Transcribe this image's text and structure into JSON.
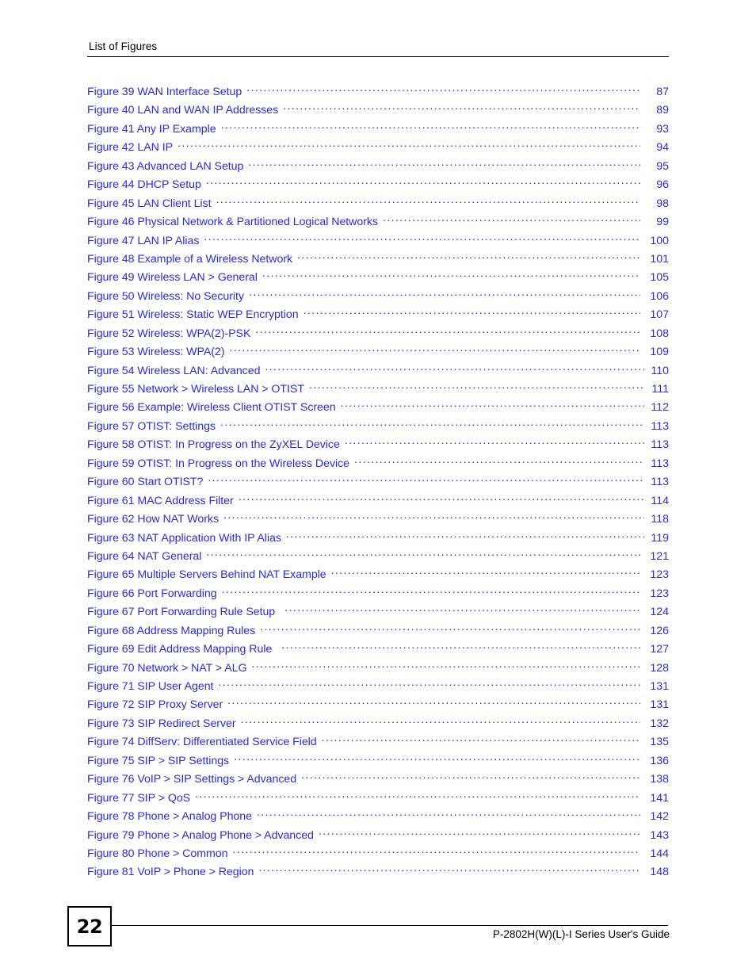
{
  "header": {
    "title": "List of Figures"
  },
  "toc": {
    "entries": [
      {
        "label": "Figure 39 WAN Interface Setup",
        "page": "87"
      },
      {
        "label": "Figure 40 LAN and WAN IP Addresses",
        "page": "89"
      },
      {
        "label": "Figure 41 Any IP Example",
        "page": "93"
      },
      {
        "label": "Figure 42 LAN IP",
        "page": "94"
      },
      {
        "label": "Figure 43 Advanced LAN Setup",
        "page": "95"
      },
      {
        "label": "Figure 44 DHCP Setup",
        "page": "96"
      },
      {
        "label": "Figure 45 LAN Client List",
        "page": "98"
      },
      {
        "label": "Figure 46 Physical Network & Partitioned Logical Networks",
        "page": "99"
      },
      {
        "label": "Figure 47 LAN IP Alias",
        "page": "100"
      },
      {
        "label": "Figure 48 Example of a Wireless Network",
        "page": "101"
      },
      {
        "label": "Figure 49 Wireless LAN > General",
        "page": "105"
      },
      {
        "label": "Figure 50 Wireless: No Security",
        "page": "106"
      },
      {
        "label": "Figure 51 Wireless: Static WEP Encryption",
        "page": "107"
      },
      {
        "label": "Figure 52 Wireless: WPA(2)-PSK",
        "page": "108"
      },
      {
        "label": "Figure 53 Wireless: WPA(2)",
        "page": "109"
      },
      {
        "label": "Figure 54 Wireless LAN: Advanced",
        "page": "110"
      },
      {
        "label": "Figure 55 Network > Wireless LAN > OTIST",
        "page": "111"
      },
      {
        "label": "Figure 56 Example: Wireless Client OTIST Screen",
        "page": "112"
      },
      {
        "label": "Figure 57 OTIST: Settings",
        "page": "113"
      },
      {
        "label": "Figure 58 OTIST: In Progress on the ZyXEL Device",
        "page": "113"
      },
      {
        "label": "Figure 59 OTIST: In Progress on the Wireless Device",
        "page": "113"
      },
      {
        "label": "Figure 60 Start OTIST?",
        "page": "113"
      },
      {
        "label": "Figure 61 MAC Address Filter",
        "page": "114"
      },
      {
        "label": "Figure 62 How NAT Works",
        "page": "118"
      },
      {
        "label": "Figure 63 NAT Application With IP Alias",
        "page": "119"
      },
      {
        "label": "Figure 64 NAT General",
        "page": "121"
      },
      {
        "label": "Figure 65 Multiple Servers Behind NAT Example",
        "page": "123"
      },
      {
        "label": "Figure 66 Port Forwarding",
        "page": "123"
      },
      {
        "label": "Figure 67 Port Forwarding Rule Setup",
        "page": "124"
      },
      {
        "label": "Figure 68 Address Mapping Rules",
        "page": "126"
      },
      {
        "label": "Figure 69 Edit Address Mapping Rule",
        "page": "127"
      },
      {
        "label": "Figure 70 Network > NAT > ALG",
        "page": "128"
      },
      {
        "label": "Figure 71 SIP User Agent",
        "page": "131"
      },
      {
        "label": "Figure 72 SIP Proxy Server",
        "page": "131"
      },
      {
        "label": "Figure 73 SIP Redirect Server",
        "page": "132"
      },
      {
        "label": "Figure 74 DiffServ: Differentiated Service Field",
        "page": "135"
      },
      {
        "label": "Figure 75 SIP > SIP Settings",
        "page": "136"
      },
      {
        "label": "Figure 76 VoIP > SIP Settings > Advanced",
        "page": "138"
      },
      {
        "label": "Figure 77 SIP > QoS",
        "page": "141"
      },
      {
        "label": "Figure 78 Phone > Analog Phone",
        "page": "142"
      },
      {
        "label": "Figure 79 Phone > Analog Phone > Advanced",
        "page": "143"
      },
      {
        "label": "Figure 80 Phone > Common",
        "page": "144"
      },
      {
        "label": "Figure 81 VoIP > Phone > Region",
        "page": "148"
      }
    ]
  },
  "footer": {
    "page_number": "22",
    "document_title": "P-2802H(W)(L)-I Series User's Guide"
  },
  "colors": {
    "link_blue": "#2b2bd4",
    "text_black": "#000000",
    "page_background": "#ffffff"
  }
}
